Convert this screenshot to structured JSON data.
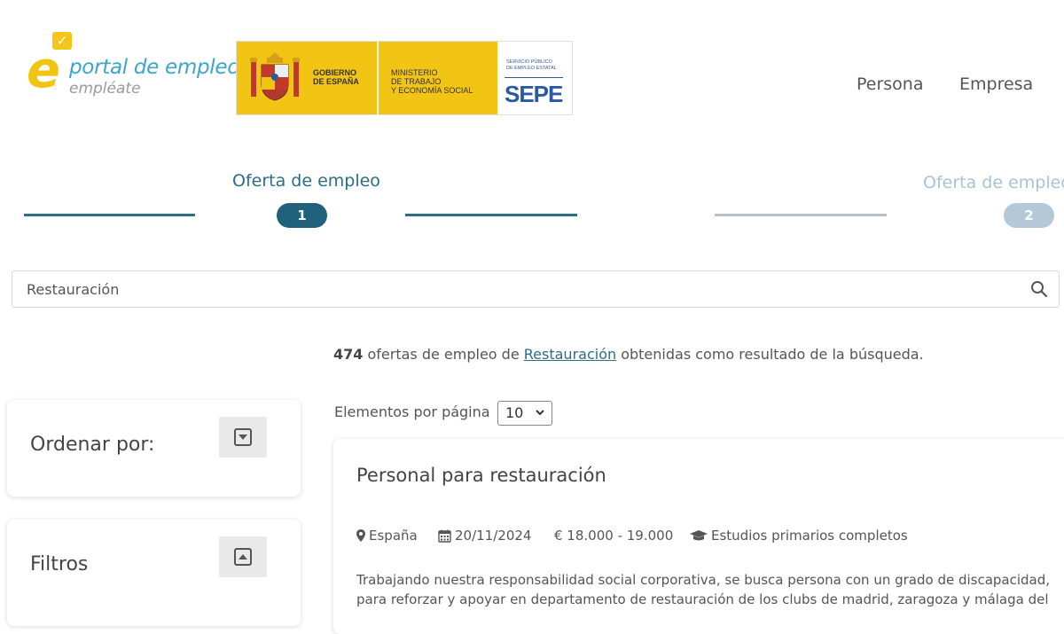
{
  "header": {
    "brand_main": "portal de empleo",
    "brand_sub": "empléate",
    "gov_line": "GOBIERNO\nDE ESPAÑA",
    "ministry_line": "MINISTERIO\nDE TRABAJO\nY ECONOMÍA SOCIAL",
    "sepe_small": "SERVICIO PÚBLICO\nDE EMPLEO ESTATAL",
    "sepe_word": "SEPE",
    "nav": {
      "persona": "Persona",
      "empresa": "Empresa"
    }
  },
  "steps": {
    "step1_label": "Oferta de empleo",
    "step1_number": "1",
    "step2_label": "Oferta de empleo",
    "step2_number": "2"
  },
  "search": {
    "value": "Restauración",
    "icon": "search-icon"
  },
  "results": {
    "count": "474",
    "text_before": " ofertas de empleo de ",
    "query_link": "Restauración",
    "text_after": " obtenidas como resultado de la búsqueda."
  },
  "pagination": {
    "label": "Elementos por página",
    "selected": "10"
  },
  "sidebar": {
    "sort_label": "Ordenar por:",
    "filters_label": "Filtros"
  },
  "job": {
    "title": "Personal para restauración",
    "location": "España",
    "date": "20/11/2024",
    "salary": "€ 18.000 - 19.000",
    "education": "Estudios primarios completos",
    "description": "Trabajando nuestra responsabilidad social corporativa, se busca persona con un grado de discapacidad, para reforzar y apoyar en departamento de restauración de los clubs de madrid, zaragoza y málaga del"
  },
  "colors": {
    "accent": "#2a6f86",
    "accent_light": "#b4c8d8",
    "brand_yellow": "#f2c413",
    "sepe_blue": "#2c5aa0"
  }
}
